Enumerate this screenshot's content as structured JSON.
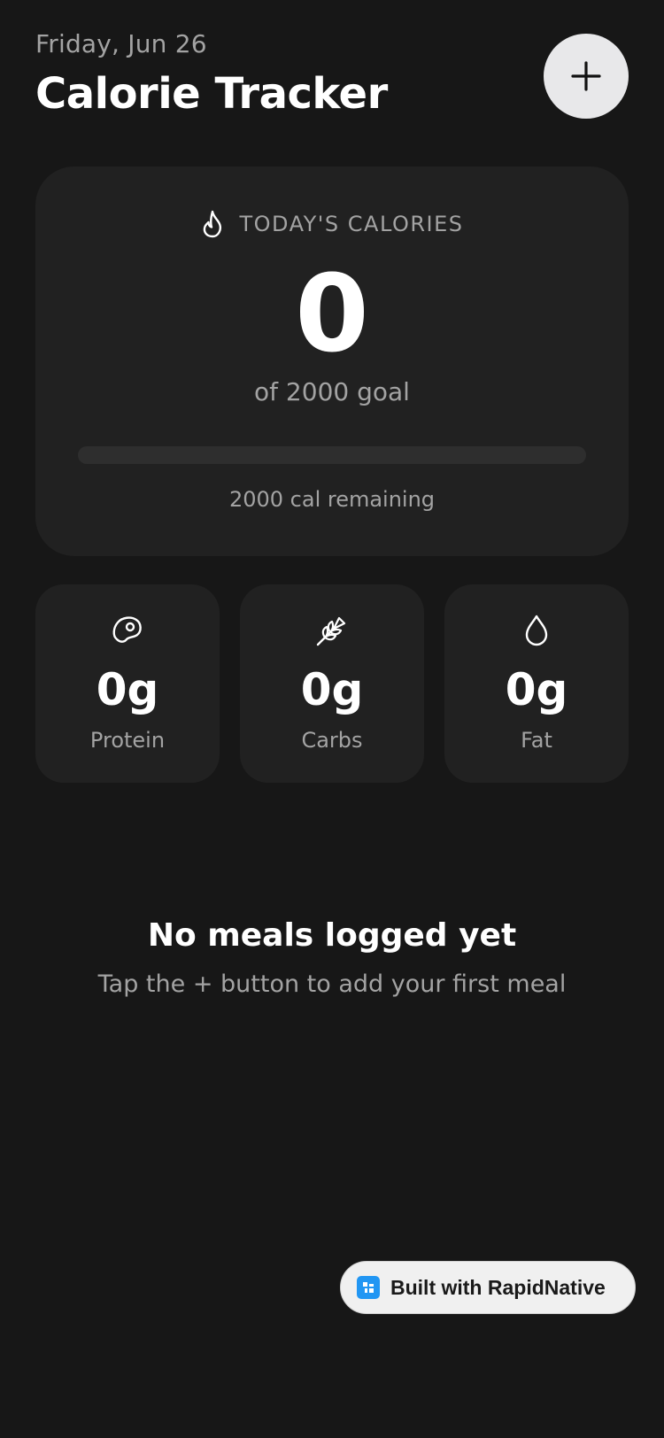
{
  "header": {
    "date": "Friday, Jun 26",
    "title": "Calorie Tracker",
    "add_button_icon": "plus-icon"
  },
  "calories": {
    "label_icon": "flame-icon",
    "label": "TODAY'S CALORIES",
    "value": "0",
    "goal_text": "of 2000 goal",
    "progress_fraction": 0,
    "remaining_text": "2000 cal remaining"
  },
  "macros": [
    {
      "icon": "steak-icon",
      "value": "0g",
      "label": "Protein"
    },
    {
      "icon": "wheat-icon",
      "value": "0g",
      "label": "Carbs"
    },
    {
      "icon": "droplet-icon",
      "value": "0g",
      "label": "Fat"
    }
  ],
  "empty_state": {
    "title": "No meals logged yet",
    "subtitle": "Tap the + button to add your first meal"
  },
  "badge": {
    "text": "Built with RapidNative",
    "logo_color": "#2196f3"
  },
  "colors": {
    "background": "#171717",
    "card": "#212121",
    "muted_text": "#a3a3a3",
    "accent_button": "#e8e8ea"
  }
}
